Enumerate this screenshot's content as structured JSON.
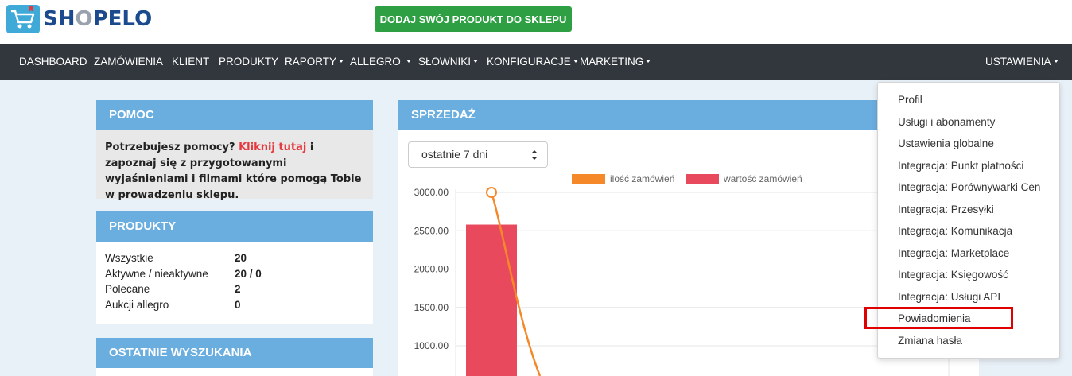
{
  "brand": {
    "name_prefix": "SH",
    "name_o": "O",
    "name_suffix": "PELO"
  },
  "header": {
    "add_product_label": "DODAJ SWÓJ PRODUKT DO SKLEPU"
  },
  "nav": {
    "items": [
      {
        "label": "DASHBOARD",
        "dropdown": false
      },
      {
        "label": "ZAMÓWIENIA",
        "dropdown": false
      },
      {
        "label": "KLIENT",
        "dropdown": false
      },
      {
        "label": "PRODUKTY",
        "dropdown": false
      },
      {
        "label": "RAPORTY",
        "dropdown": true
      },
      {
        "label": "ALLEGRO",
        "dropdown": true
      },
      {
        "label": "SŁOWNIKI",
        "dropdown": true
      },
      {
        "label": "KONFIGURACJE",
        "dropdown": true
      },
      {
        "label": "MARKETING",
        "dropdown": true
      }
    ],
    "settings_label": "USTAWIENIA"
  },
  "help_panel": {
    "title": "POMOC",
    "text_before": "Potrzebujesz pomocy? ",
    "link_text": "Kliknij tutaj",
    "text_after": " i zapoznaj się z przygotowanymi wyjaśnieniami i filmami które pomogą Tobie w prowadzeniu sklepu."
  },
  "products_panel": {
    "title": "PRODUKTY",
    "rows": [
      {
        "label": "Wszystkie",
        "value": "20"
      },
      {
        "label": "Aktywne / nieaktywne",
        "value": "20 / 0"
      },
      {
        "label": "Polecane",
        "value": "2"
      },
      {
        "label": "Aukcji allegro",
        "value": "0"
      }
    ]
  },
  "searches_panel": {
    "title": "OSTATNIE WYSZUKANIA"
  },
  "sales_panel": {
    "title": "SPRZEDAŻ",
    "period_selected": "ostatnie 7 dni"
  },
  "chart_data": {
    "type": "bar",
    "series": [
      {
        "name": "ilość zamówień",
        "kind": "line",
        "color": "#f5892a",
        "values": [
          3000,
          0
        ]
      },
      {
        "name": "wartość zamówień",
        "kind": "bar",
        "color": "#e8495d",
        "values": [
          2580
        ]
      }
    ],
    "y_ticks": [
      "3000.00",
      "2500.00",
      "2000.00",
      "1500.00",
      "1000.00"
    ],
    "ylim": [
      1000,
      3000
    ],
    "grid": true,
    "legend": "top"
  },
  "settings_menu": {
    "items": [
      "Profil",
      "Usługi i abonamenty",
      "Ustawienia globalne",
      "Integracja: Punkt płatności",
      "Integracja: Porównywarki Cen",
      "Integracja: Przesyłki",
      "Integracja: Komunikacja",
      "Integracja: Marketplace",
      "Integracja: Księgowość",
      "Integracja: Usługi API",
      "Powiadomienia",
      "Zmiana hasła"
    ],
    "highlighted": "Powiadomienia"
  },
  "colors": {
    "nav_bg": "#32373d",
    "panel_header": "#6aaee0",
    "primary_button": "#2ea043",
    "link_red": "#e5393f",
    "highlight": "#e00000"
  }
}
